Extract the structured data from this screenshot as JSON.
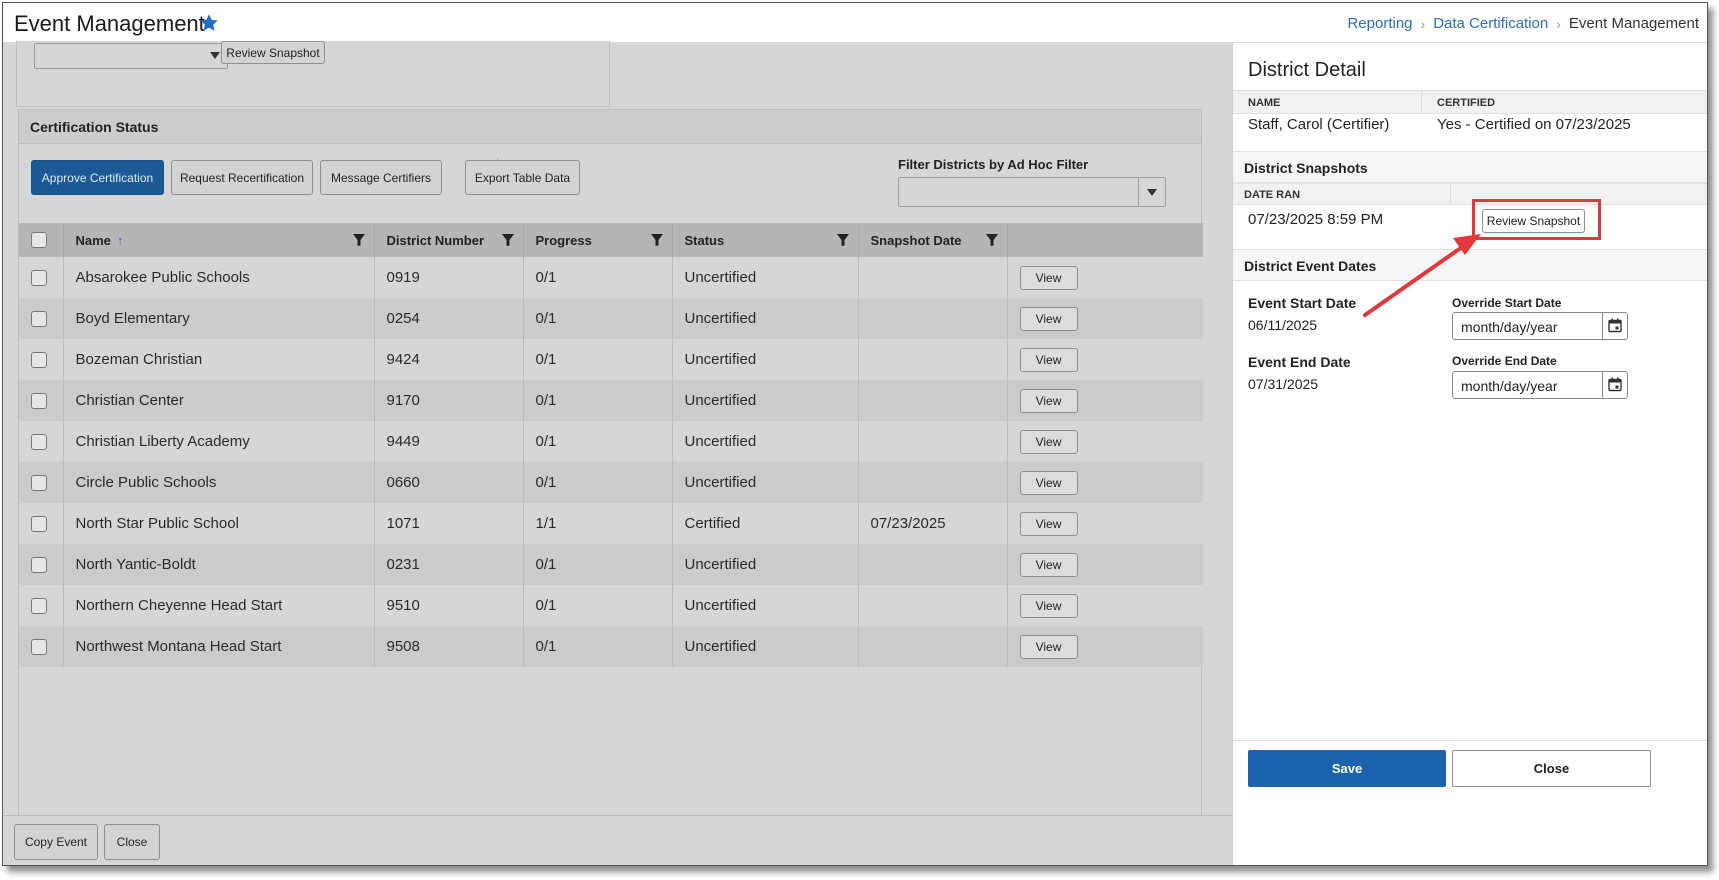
{
  "header": {
    "title": "Event Management",
    "breadcrumb": [
      "Reporting",
      "Data Certification",
      "Event Management"
    ]
  },
  "top_panel": {
    "select_value": "",
    "review_snapshot_label": "Review Snapshot"
  },
  "certification": {
    "title": "Certification Status",
    "buttons": {
      "approve": "Approve Certification",
      "request": "Request Recertification",
      "message": "Message Certifiers",
      "export": "Export Table Data"
    },
    "filter_label": "Filter Districts by Ad Hoc Filter",
    "filter_value": "",
    "columns": [
      "Name",
      "District Number",
      "Progress",
      "Status",
      "Snapshot Date"
    ],
    "view_label": "View",
    "rows": [
      {
        "name": "Absarokee Public Schools",
        "number": "0919",
        "progress": "0/1",
        "status": "Uncertified",
        "snapshot": ""
      },
      {
        "name": "Boyd Elementary",
        "number": "0254",
        "progress": "0/1",
        "status": "Uncertified",
        "snapshot": ""
      },
      {
        "name": "Bozeman Christian",
        "number": "9424",
        "progress": "0/1",
        "status": "Uncertified",
        "snapshot": ""
      },
      {
        "name": "Christian Center",
        "number": "9170",
        "progress": "0/1",
        "status": "Uncertified",
        "snapshot": ""
      },
      {
        "name": "Christian Liberty Academy",
        "number": "9449",
        "progress": "0/1",
        "status": "Uncertified",
        "snapshot": ""
      },
      {
        "name": "Circle Public Schools",
        "number": "0660",
        "progress": "0/1",
        "status": "Uncertified",
        "snapshot": ""
      },
      {
        "name": "North Star Public School",
        "number": "1071",
        "progress": "1/1",
        "status": "Certified",
        "snapshot": "07/23/2025"
      },
      {
        "name": "North Yantic-Boldt",
        "number": "0231",
        "progress": "0/1",
        "status": "Uncertified",
        "snapshot": ""
      },
      {
        "name": "Northern Cheyenne Head Start",
        "number": "9510",
        "progress": "0/1",
        "status": "Uncertified",
        "snapshot": ""
      },
      {
        "name": "Northwest Montana Head Start",
        "number": "9508",
        "progress": "0/1",
        "status": "Uncertified",
        "snapshot": ""
      }
    ]
  },
  "left_footer": {
    "copy_event": "Copy Event",
    "close": "Close"
  },
  "district_detail": {
    "title": "District Detail",
    "name_header": "NAME",
    "certified_header": "CERTIFIED",
    "name_value": "Staff, Carol (Certifier)",
    "certified_value": "Yes - Certified on 07/23/2025",
    "snapshots_title": "District Snapshots",
    "date_ran_header": "DATE RAN",
    "date_ran_value": "07/23/2025 8:59 PM",
    "review_snapshot_label": "Review Snapshot",
    "event_dates_title": "District Event Dates",
    "event_start_label": "Event Start Date",
    "event_start_value": "06/11/2025",
    "override_start_label": "Override Start Date",
    "override_start_value": "month/day/year",
    "event_end_label": "Event End Date",
    "event_end_value": "07/31/2025",
    "override_end_label": "Override End Date",
    "override_end_value": "month/day/year",
    "save_label": "Save",
    "close_label": "Close"
  },
  "colors": {
    "primary_blue": "#1c63ad",
    "link_blue": "#2a6fb5",
    "highlight_red": "#e2383c"
  }
}
